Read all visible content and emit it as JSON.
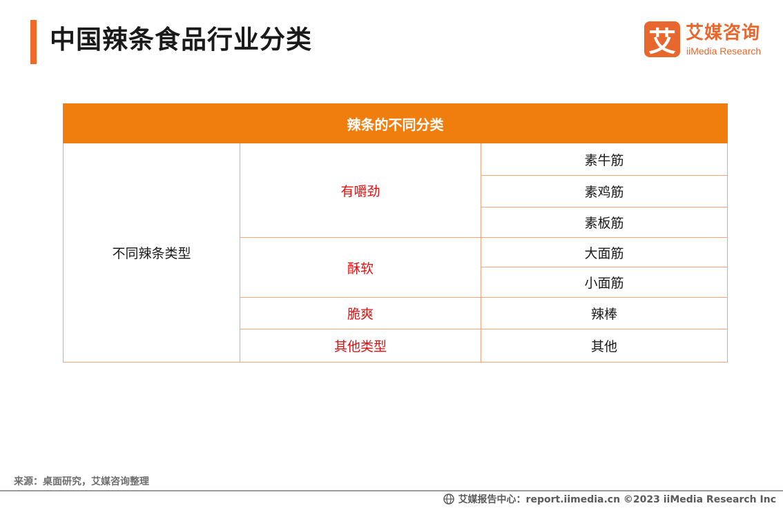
{
  "header": {
    "title": "中国辣条食品行业分类",
    "logo": {
      "mark": "艾",
      "name_cn": "艾媒咨询",
      "name_en": "iiMedia Research",
      "brand_color": "#e8672e",
      "icon": "iimedia-logo-icon"
    }
  },
  "table": {
    "heading": "辣条的不同分类",
    "category": "不同辣条类型",
    "groups": [
      {
        "label": "有嚼劲",
        "items": [
          "素牛筋",
          "素鸡筋",
          "素板筋"
        ]
      },
      {
        "label": "酥软",
        "items": [
          "大面筋",
          "小面筋"
        ]
      },
      {
        "label": "脆爽",
        "items": [
          "辣棒"
        ]
      },
      {
        "label": "其他类型",
        "items": [
          "其他"
        ]
      }
    ],
    "header_color": "#ef7e0f",
    "group_text_color": "#e01010",
    "border_color": "#f2a57a"
  },
  "source": "来源：桌面研究，艾媒咨询整理",
  "footer": {
    "icon": "globe-icon",
    "text": "艾媒报告中心：report.iimedia.cn  ©2023  iiMedia Research  Inc"
  }
}
